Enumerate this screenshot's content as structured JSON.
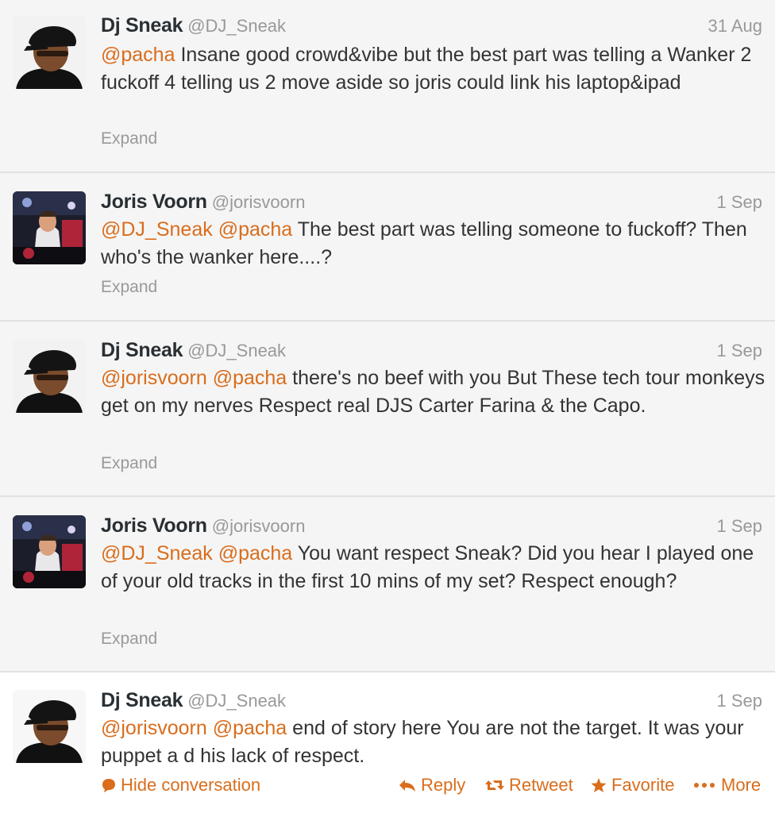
{
  "tweets": [
    {
      "name": "Dj Sneak",
      "handle": "@DJ_Sneak",
      "time": "31 Aug",
      "mentions": [
        "@pacha"
      ],
      "text": "Insane good crowd&vibe but the best part was telling a Wanker 2 fuckoff 4 telling us 2 move aside so joris could link his laptop&ipad",
      "expand": "Expand"
    },
    {
      "name": "Joris Voorn",
      "handle": "@jorisvoorn",
      "time": "1 Sep",
      "mentions": [
        "@DJ_Sneak",
        "@pacha"
      ],
      "text": "The best part was telling someone to fuckoff? Then who's the wanker here....?",
      "expand": "Expand"
    },
    {
      "name": "Dj Sneak",
      "handle": "@DJ_Sneak",
      "time": "1 Sep",
      "mentions": [
        "@jorisvoorn",
        "@pacha"
      ],
      "text": "there's no beef with you But These tech tour monkeys get on my nerves Respect real DJS  Carter Farina & the Capo.",
      "expand": "Expand"
    },
    {
      "name": "Joris Voorn",
      "handle": "@jorisvoorn",
      "time": "1 Sep",
      "mentions": [
        "@DJ_Sneak",
        "@pacha"
      ],
      "text": "You want respect Sneak? Did you hear I played one of your old tracks in the first 10 mins of my set? Respect enough?",
      "expand": "Expand"
    },
    {
      "name": "Dj Sneak",
      "handle": "@DJ_Sneak",
      "time": "1 Sep",
      "mentions": [
        "@jorisvoorn",
        "@pacha"
      ],
      "text": "end of story here   You are not the target. It was your puppet a d his lack of respect."
    }
  ],
  "actions": {
    "hide_conversation": "Hide conversation",
    "reply": "Reply",
    "retweet": "Retweet",
    "favorite": "Favorite",
    "more": "More"
  },
  "colors": {
    "accent": "#d96d1c",
    "muted": "#999999",
    "text": "#333333",
    "divider": "#e1e1e1"
  }
}
